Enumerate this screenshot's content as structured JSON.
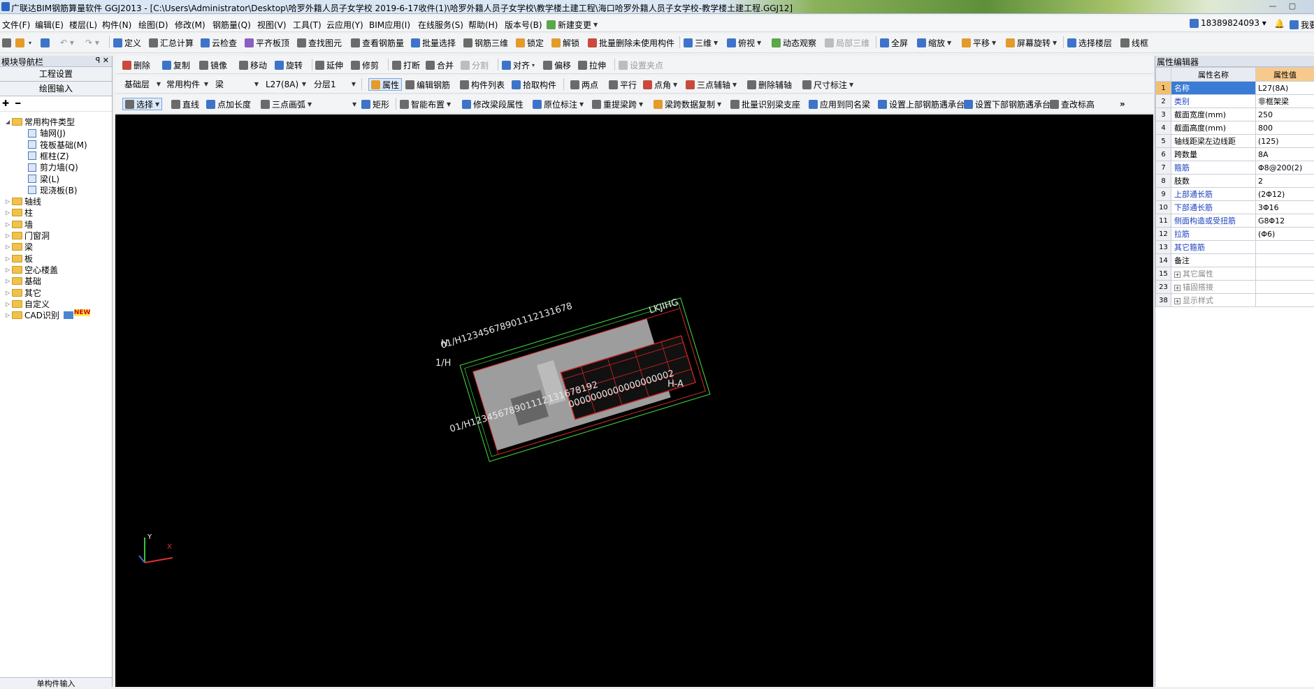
{
  "title": "广联达BIM钢筋算量软件 GGJ2013 - [C:\\Users\\Administrator\\Desktop\\哈罗外籍人员子女学校  2019-6-17收件(1)\\哈罗外籍人员子女学校\\教学楼土建工程\\海口哈罗外籍人员子女学校-教学楼土建工程.GGJ12]",
  "window_buttons": [
    "—",
    "▢"
  ],
  "menu": [
    "文件(F)",
    "编辑(E)",
    "楼层(L)",
    "构件(N)",
    "绘图(D)",
    "修改(M)",
    "钢筋量(Q)",
    "视图(V)",
    "工具(T)",
    "云应用(Y)",
    "BIM应用(I)",
    "在线服务(S)",
    "帮助(H)",
    "版本号(B)",
    "新建变更"
  ],
  "phone": "18389824093",
  "corner_label": "我要",
  "toolbar1": [
    "定义",
    "汇总计算",
    "云检查",
    "平齐板顶",
    "查找图元",
    "查看钢筋量",
    "批量选择",
    "钢筋三维",
    "锁定",
    "解锁",
    "批量删除未使用构件",
    "三维",
    "俯视",
    "动态观察",
    "局部三维",
    "全屏",
    "缩放",
    "平移",
    "屏幕旋转",
    "选择楼层",
    "线框"
  ],
  "toolbar2": [
    "删除",
    "复制",
    "镜像",
    "移动",
    "旋转",
    "延伸",
    "修剪",
    "打断",
    "合并",
    "分割",
    "对齐",
    "偏移",
    "拉伸",
    "设置夹点"
  ],
  "toolbar3": {
    "combos": [
      "基础层",
      "常用构件",
      "梁",
      "L27(8A)",
      "分层1"
    ],
    "buttons": [
      "属性",
      "编辑钢筋",
      "构件列表",
      "拾取构件",
      "两点",
      "平行",
      "点角",
      "三点辅轴",
      "删除辅轴",
      "尺寸标注"
    ]
  },
  "toolbar4": [
    "选择",
    "直线",
    "点加长度",
    "三点画弧",
    "矩形",
    "智能布置",
    "修改梁段属性",
    "原位标注",
    "重提梁跨",
    "梁跨数据复制",
    "批量识别梁支座",
    "应用到同名梁",
    "设置上部钢筋遇承台",
    "设置下部钢筋遇承台",
    "查改标高"
  ],
  "left_panel": {
    "title": "模块导航栏",
    "pins": "ꟼ ✕",
    "btn_project": "工程设置",
    "btn_draw": "绘图输入",
    "bottom": "单构件输入",
    "tree": [
      {
        "label": "常用构件类型",
        "exp": "◢"
      },
      {
        "label": "轴网(J)"
      },
      {
        "label": "筏板基础(M)"
      },
      {
        "label": "框柱(Z)"
      },
      {
        "label": "剪力墙(Q)"
      },
      {
        "label": "梁(L)"
      },
      {
        "label": "现浇板(B)"
      },
      {
        "label": "轴线",
        "exp": "▷"
      },
      {
        "label": "柱",
        "exp": "▷"
      },
      {
        "label": "墙",
        "exp": "▷"
      },
      {
        "label": "门窗洞",
        "exp": "▷"
      },
      {
        "label": "梁",
        "exp": "▷"
      },
      {
        "label": "板",
        "exp": "▷"
      },
      {
        "label": "空心楼盖",
        "exp": "▷"
      },
      {
        "label": "基础",
        "exp": "▷"
      },
      {
        "label": "其它",
        "exp": "▷"
      },
      {
        "label": "自定义",
        "exp": "▷"
      },
      {
        "label": "CAD识别",
        "exp": "▷",
        "badge": "NEW"
      }
    ]
  },
  "right_panel": {
    "title": "属性编辑器",
    "col_name": "属性名称",
    "col_value": "属性值",
    "rows": [
      {
        "n": "1",
        "name": "名称",
        "value": "L27(8A)",
        "style": "sel"
      },
      {
        "n": "2",
        "name": "类别",
        "value": "非框架梁",
        "style": "blue"
      },
      {
        "n": "3",
        "name": "截面宽度(mm)",
        "value": "250",
        "style": ""
      },
      {
        "n": "4",
        "name": "截面高度(mm)",
        "value": "800",
        "style": ""
      },
      {
        "n": "5",
        "name": "轴线距梁左边线距",
        "value": "(125)",
        "style": ""
      },
      {
        "n": "6",
        "name": "跨数量",
        "value": "8A",
        "style": ""
      },
      {
        "n": "7",
        "name": "箍筋",
        "value": "Φ8@200(2)",
        "style": "blue"
      },
      {
        "n": "8",
        "name": "肢数",
        "value": "2",
        "style": ""
      },
      {
        "n": "9",
        "name": "上部通长筋",
        "value": "(2Φ12)",
        "style": "blue"
      },
      {
        "n": "10",
        "name": "下部通长筋",
        "value": "3Φ16",
        "style": "blue"
      },
      {
        "n": "11",
        "name": "侧面构造或受扭筋",
        "value": "G8Φ12",
        "style": "blue"
      },
      {
        "n": "12",
        "name": "拉筋",
        "value": "(Φ6)",
        "style": "blue"
      },
      {
        "n": "13",
        "name": "其它箍筋",
        "value": "",
        "style": "blue"
      },
      {
        "n": "14",
        "name": "备注",
        "value": "",
        "style": ""
      },
      {
        "n": "15",
        "name": "其它属性",
        "value": "",
        "style": "gray",
        "plus": true
      },
      {
        "n": "23",
        "name": "锚固搭接",
        "value": "",
        "style": "gray",
        "plus": true
      },
      {
        "n": "38",
        "name": "显示样式",
        "value": "",
        "style": "gray",
        "plus": true
      }
    ]
  },
  "axis_labels": {
    "x": "X",
    "y": "Y"
  },
  "colors": {
    "canvas_bg": "#000000",
    "accent_select": "#3a7bd5",
    "header_value": "#f7c98d"
  }
}
